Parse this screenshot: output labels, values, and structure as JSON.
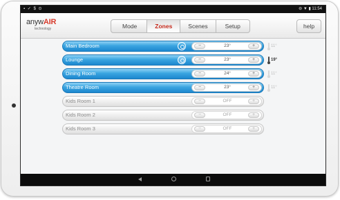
{
  "status_bar": {
    "left_icons": "▪ ✓ $ ⊙",
    "right_text": "⊖ ▼ ▮ 11:54"
  },
  "app": {
    "logo_text_main": "anyw",
    "logo_text_accent": "AIR",
    "logo_subtitle": "technology",
    "accent_color": "#c62a1d"
  },
  "tabs": [
    {
      "label": "Mode",
      "active": false
    },
    {
      "label": "Zones",
      "active": true
    },
    {
      "label": "Scenes",
      "active": false
    },
    {
      "label": "Setup",
      "active": false
    }
  ],
  "help_label": "help",
  "zones": [
    {
      "name": "Main Bedroom",
      "on": true,
      "selected": false,
      "setpoint": "23°",
      "minus": "−",
      "plus": "+",
      "actual_temp": "11°",
      "temp_dark": false
    },
    {
      "name": "Lounge",
      "on": true,
      "selected": true,
      "setpoint": "23°",
      "minus": "−",
      "plus": "+",
      "actual_temp": "19°",
      "temp_dark": true
    },
    {
      "name": "Dining Room",
      "on": true,
      "selected": false,
      "setpoint": "24°",
      "minus": "−",
      "plus": "+",
      "actual_temp": "11°",
      "temp_dark": false
    },
    {
      "name": "Theatre Room",
      "on": true,
      "selected": false,
      "setpoint": "23°",
      "minus": "−",
      "plus": "+",
      "actual_temp": "11°",
      "temp_dark": false
    },
    {
      "name": "Kids Room 1",
      "on": false,
      "selected": false,
      "setpoint": "OFF",
      "minus": "−",
      "plus": "+",
      "actual_temp": "",
      "temp_dark": false
    },
    {
      "name": "Kids Room 2",
      "on": false,
      "selected": false,
      "setpoint": "OFF",
      "minus": "−",
      "plus": "+",
      "actual_temp": "",
      "temp_dark": false
    },
    {
      "name": "Kids Room 3",
      "on": false,
      "selected": false,
      "setpoint": "OFF",
      "minus": "−",
      "plus": "+",
      "actual_temp": "",
      "temp_dark": false
    }
  ],
  "colors": {
    "zone_on_top": "#8fd2f5",
    "zone_on_bottom": "#1d87cf",
    "zone_off": "#dfdfdf"
  },
  "nav_icons": [
    "back-icon",
    "home-icon",
    "recents-icon"
  ]
}
